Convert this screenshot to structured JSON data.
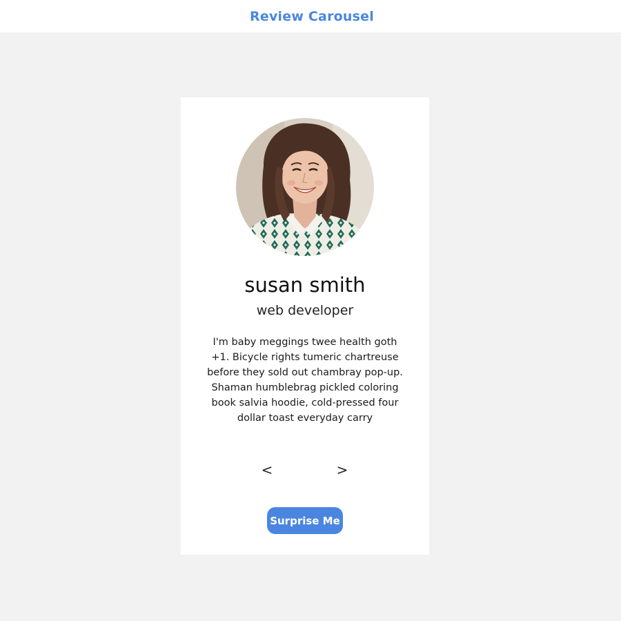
{
  "header": {
    "title": "Review Carousel"
  },
  "review": {
    "name": "susan smith",
    "job": "web developer",
    "text": "I'm baby meggings twee health goth +1. Bicycle rights tumeric chartreuse before they sold out chambray pop-up. Shaman humblebrag pickled coloring book salvia hoodie, cold-pressed four dollar toast everyday carry",
    "avatar_alt": "susan smith"
  },
  "controls": {
    "prev_label": "<",
    "next_label": ">",
    "surprise_label": "Surprise Me"
  },
  "colors": {
    "accent": "#4a86e0",
    "page_background": "#f2f2f2",
    "card_background": "#ffffff"
  }
}
